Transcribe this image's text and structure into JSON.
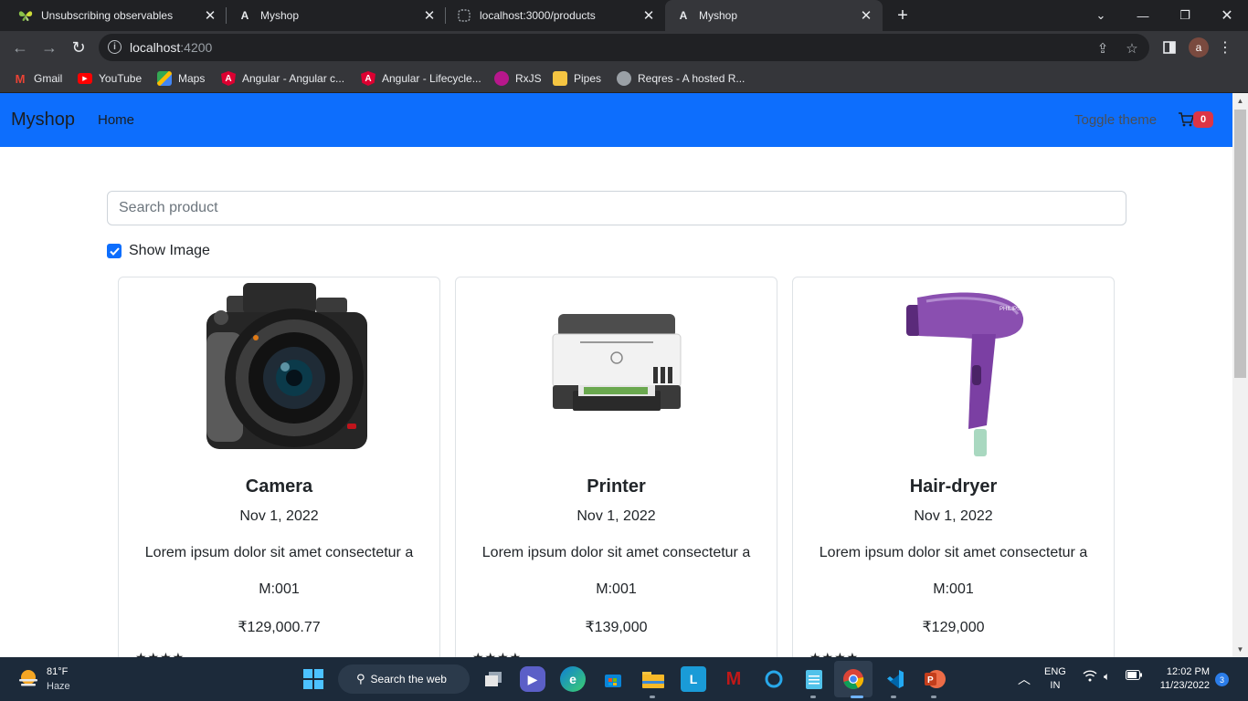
{
  "browser": {
    "tabs": [
      {
        "title": "Unsubscribing observables",
        "icon": "butterfly-icon",
        "active": false
      },
      {
        "title": "Myshop",
        "icon": "angular-icon",
        "active": false
      },
      {
        "title": "localhost:3000/products",
        "icon": "globe-icon",
        "active": false
      },
      {
        "title": "Myshop",
        "icon": "angular-icon",
        "active": true
      }
    ],
    "url_host": "localhost",
    "url_port": ":4200",
    "profile_initial": "a",
    "bookmarks": [
      {
        "label": "Gmail",
        "icon": "gmail-icon"
      },
      {
        "label": "YouTube",
        "icon": "youtube-icon"
      },
      {
        "label": "Maps",
        "icon": "maps-icon"
      },
      {
        "label": "Angular - Angular c...",
        "icon": "angular-icon"
      },
      {
        "label": "Angular - Lifecycle...",
        "icon": "angular-icon"
      },
      {
        "label": "RxJS",
        "icon": "rxjs-icon"
      },
      {
        "label": "Pipes",
        "icon": "folder-icon"
      },
      {
        "label": "Reqres - A hosted R...",
        "icon": "globe-icon"
      }
    ]
  },
  "app": {
    "brand": "Myshop",
    "nav_home": "Home",
    "toggle_theme": "Toggle theme",
    "cart_count": "0",
    "search_placeholder": "Search product",
    "show_image_label": "Show Image",
    "show_image_checked": true,
    "products": [
      {
        "name": "Camera",
        "date": "Nov 1, 2022",
        "description": "Lorem ipsum dolor sit amet consectetur a",
        "model": "M:001",
        "price": "₹129,000.77",
        "rating_stars": 4,
        "image": "camera"
      },
      {
        "name": "Printer",
        "date": "Nov 1, 2022",
        "description": "Lorem ipsum dolor sit amet consectetur a",
        "model": "M:001",
        "price": "₹139,000",
        "rating_stars": 4,
        "image": "printer"
      },
      {
        "name": "Hair-dryer",
        "date": "Nov 1, 2022",
        "description": "Lorem ipsum dolor sit amet consectetur a",
        "model": "M:001",
        "price": "₹129,000",
        "rating_stars": 4,
        "image": "hair-dryer"
      }
    ],
    "colors": {
      "navbar": "#0d6efd",
      "badge": "#dc3545"
    }
  },
  "taskbar": {
    "weather_temp": "81°F",
    "weather_desc": "Haze",
    "search_label": "Search the web",
    "lang_top": "ENG",
    "lang_bottom": "IN",
    "time": "12:02 PM",
    "date": "11/23/2022",
    "notification_count": "3"
  }
}
